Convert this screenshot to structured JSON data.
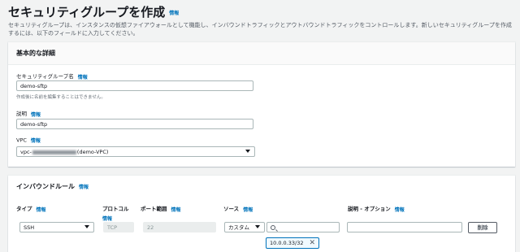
{
  "page": {
    "title": "セキュリティグループを作成",
    "title_info": "情報",
    "description": "セキュリティグループは、インスタンスの仮想ファイアウォールとして機能し、インバウンドトラフィックとアウトバウンドトラフィックをコントロールします。新しいセキュリティグループを作成するには、以下のフィールドに入力してください。"
  },
  "basic": {
    "heading": "基本的な詳細",
    "name_label": "セキュリティグループ名",
    "name_info": "情報",
    "name_value": "demo-sftp",
    "name_hint": "作成後に名前を編集することはできません。",
    "desc_label": "説明",
    "desc_info": "情報",
    "desc_value": "demo-sftp",
    "vpc_label": "VPC",
    "vpc_info": "情報",
    "vpc_prefix": "vpc-",
    "vpc_suffix": "(demo-VPC)"
  },
  "inbound": {
    "heading": "インバウンドルール",
    "heading_info": "情報",
    "columns": {
      "type": "タイプ",
      "type_info": "情報",
      "protocol": "プロトコル",
      "protocol_info": "情報",
      "port": "ポート範囲",
      "port_info": "情報",
      "source": "ソース",
      "source_info": "情報",
      "description": "説明 - オプション",
      "description_info": "情報"
    },
    "row": {
      "type": "SSH",
      "protocol": "TCP",
      "port": "22",
      "source_type": "カスタム",
      "source_token": "10.0.0.33/32",
      "source_token_close": "✕",
      "description": "",
      "delete_label": "削除"
    }
  },
  "colors": {
    "link": "#0073bb",
    "background": "#f2f3f3"
  }
}
